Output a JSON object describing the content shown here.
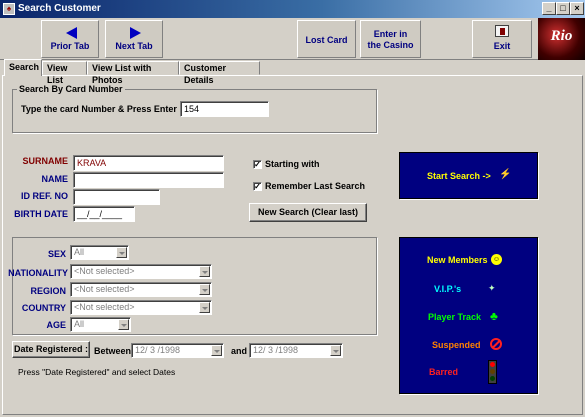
{
  "window": {
    "title": "Search Customer",
    "min_glyph": "_",
    "max_glyph": "□",
    "close_glyph": "×"
  },
  "toolbar": {
    "prior_tab": "Prior Tab",
    "next_tab": "Next Tab",
    "lost_card": "Lost Card",
    "enter_casino": "Enter in the Casino",
    "exit": "Exit",
    "logo_text": "Rio"
  },
  "tabs": [
    {
      "label": "Search"
    },
    {
      "label": "View List"
    },
    {
      "label": "View List with Photos"
    },
    {
      "label": "Customer Details"
    }
  ],
  "card_search": {
    "legend": "Search By Card Number",
    "prompt": "Type the card Number & Press Enter",
    "card_number": "154"
  },
  "person": {
    "surname_label": "SURNAME",
    "surname_value": "KRAVA",
    "name_label": "NAME",
    "name_value": "",
    "idref_label": "ID REF. NO",
    "idref_value": "",
    "birth_label": "BIRTH DATE",
    "birth_value": "__/__/____"
  },
  "options": {
    "starting_with": "Starting with",
    "remember_last": "Remember Last Search",
    "starting_checked": "✓",
    "remember_checked": "✓",
    "new_search": "New Search (Clear last)"
  },
  "filters": {
    "sex_label": "SEX",
    "sex_value": "All",
    "nationality_label": "NATIONALITY",
    "nationality_value": "<Not selected>",
    "region_label": "REGION",
    "region_value": "<Not selected>",
    "country_label": "COUNTRY",
    "country_value": "<Not selected>",
    "age_label": "AGE",
    "age_value": "All"
  },
  "date": {
    "button": "Date Registered :",
    "between": "Between",
    "from": "12/ 3 /1998",
    "and": "and",
    "to": "12/ 3 /1998",
    "hint": "Press \"Date Registered\" and select Dates"
  },
  "start_search": {
    "label": "Start Search ->"
  },
  "member_menu": [
    {
      "label": "New Members",
      "color": "#ffff00",
      "icon": "smiley-icon"
    },
    {
      "label": "V.I.P.'s",
      "color": "#00ffff",
      "icon": "vip-icon"
    },
    {
      "label": "Player Track",
      "color": "#00ff00",
      "icon": "club-icon"
    },
    {
      "label": "Suspended",
      "color": "#ff8000",
      "icon": "prohibited-icon"
    },
    {
      "label": "Barred",
      "color": "#ff0000",
      "icon": "traffic-light-icon"
    }
  ],
  "colors": {
    "navy": "#000080",
    "label_blue": "#000080",
    "surname_red": "#800000"
  }
}
